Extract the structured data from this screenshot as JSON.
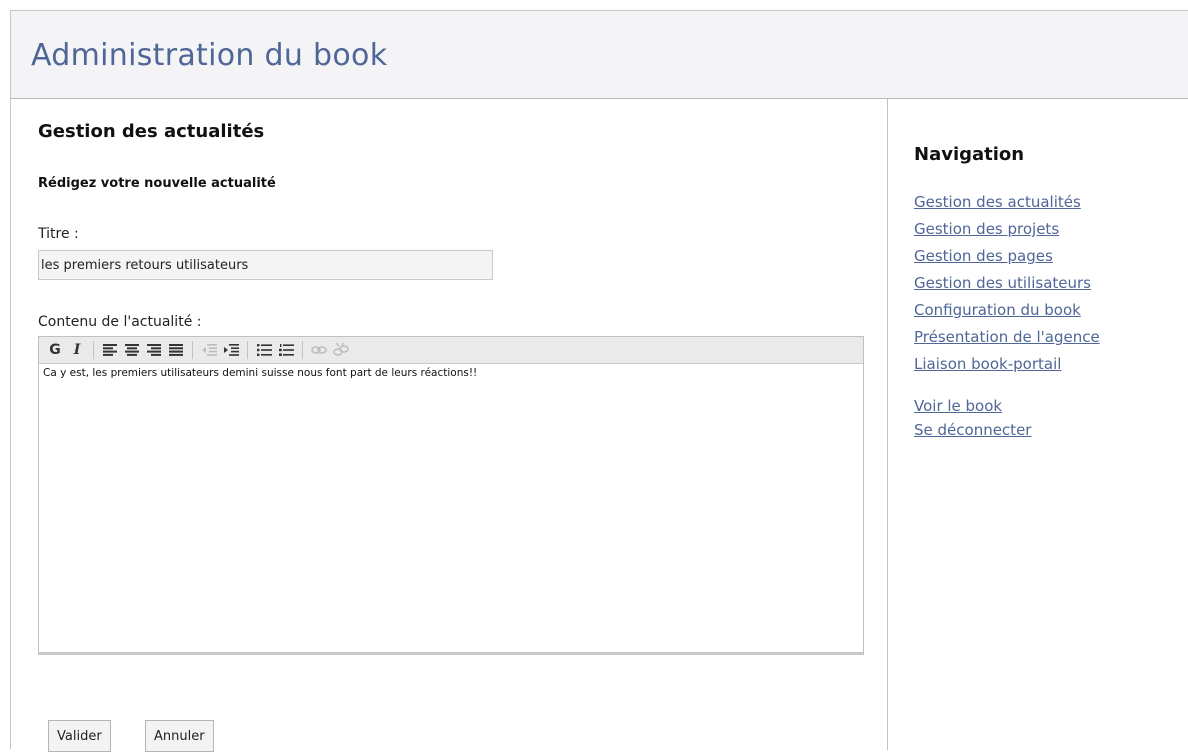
{
  "header": {
    "title": "Administration du book"
  },
  "main": {
    "section_title": "Gestion des actualités",
    "form_subtitle": "Rédigez votre nouvelle actualité",
    "title_label": "Titre :",
    "title_value": "les premiers retours utilisateurs",
    "content_label": "Contenu de l'actualité :",
    "editor": {
      "toolbar": {
        "bold_label": "G",
        "italic_label": "I",
        "icons": [
          "align-left-icon",
          "align-center-icon",
          "align-right-icon",
          "align-justify-icon",
          "outdent-icon",
          "indent-icon",
          "bullet-list-icon",
          "numbered-list-icon",
          "link-icon",
          "unlink-icon"
        ]
      },
      "content": "Ca y est, les premiers utilisateurs demini suisse nous font part de leurs réactions!!"
    },
    "buttons": {
      "submit": "Valider",
      "cancel": "Annuler"
    }
  },
  "sidebar": {
    "title": "Navigation",
    "links": [
      "Gestion des actualités",
      "Gestion des projets",
      "Gestion des pages",
      "Gestion des utilisateurs",
      "Configuration du book",
      "Présentation de l'agence",
      "Liaison book-portail"
    ],
    "secondary_links": [
      "Voir le book",
      "Se déconnecter"
    ]
  },
  "colors": {
    "accent": "#4f6697",
    "header_bg": "#f4f4f7",
    "toolbar_bg": "#eaeaea"
  }
}
